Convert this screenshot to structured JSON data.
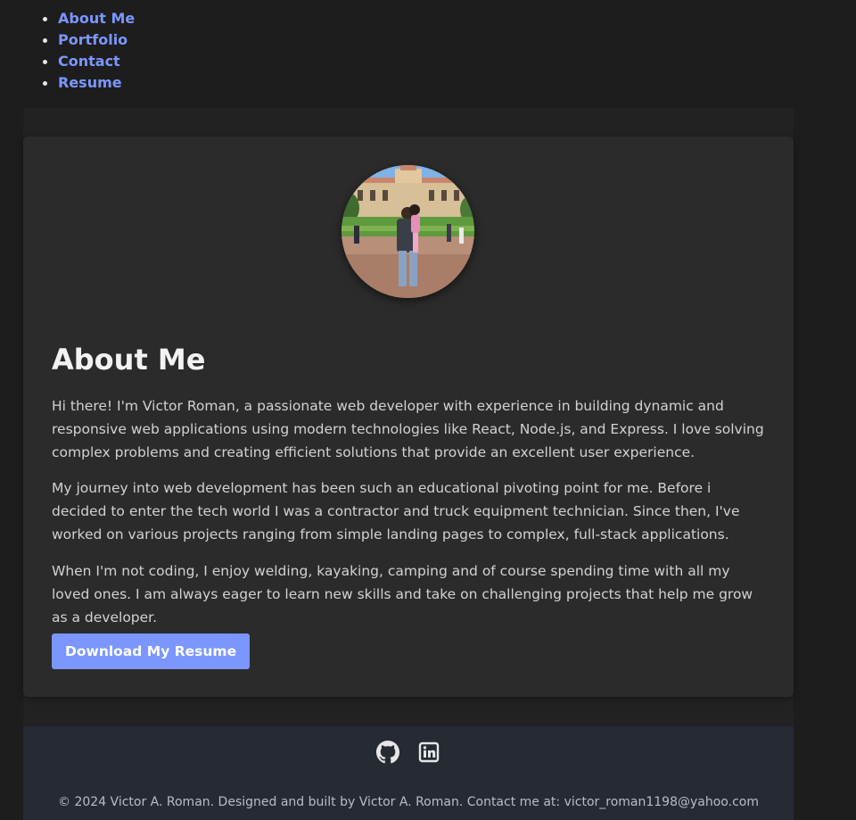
{
  "nav": {
    "items": [
      {
        "label": "About Me"
      },
      {
        "label": "Portfolio"
      },
      {
        "label": "Contact"
      },
      {
        "label": "Resume"
      }
    ]
  },
  "about": {
    "profile_icon": "profile-photo",
    "title": "About Me",
    "paragraphs": [
      "Hi there! I'm Victor Roman, a passionate web developer with experience in building dynamic and responsive web applications using modern technologies like React, Node.js, and Express. I love solving complex problems and creating efficient solutions that provide an excellent user experience.",
      "My journey into web development has been such an educational pivoting point for me. Before i decided to enter the tech world I was a contractor and truck equipment technician. Since then, I've worked on various projects ranging from simple landing pages to complex, full-stack applications.",
      "When I'm not coding, I enjoy welding, kayaking, camping and of course spending time with all my loved ones. I am always eager to learn new skills and take on challenging projects that help me grow as a developer."
    ],
    "resume_button": "Download My Resume"
  },
  "footer": {
    "social": [
      {
        "icon": "github-icon"
      },
      {
        "icon": "linkedin-icon"
      }
    ],
    "copyright": "© 2024 Victor A. Roman. Designed and built by Victor A. Roman. Contact me at: victor_roman1198@yahoo.com"
  },
  "colors": {
    "page_bg": "#1d1d1d",
    "card_bg": "#2b2b2b",
    "accent": "#7b96ff",
    "footer_bg": "#252a33"
  }
}
